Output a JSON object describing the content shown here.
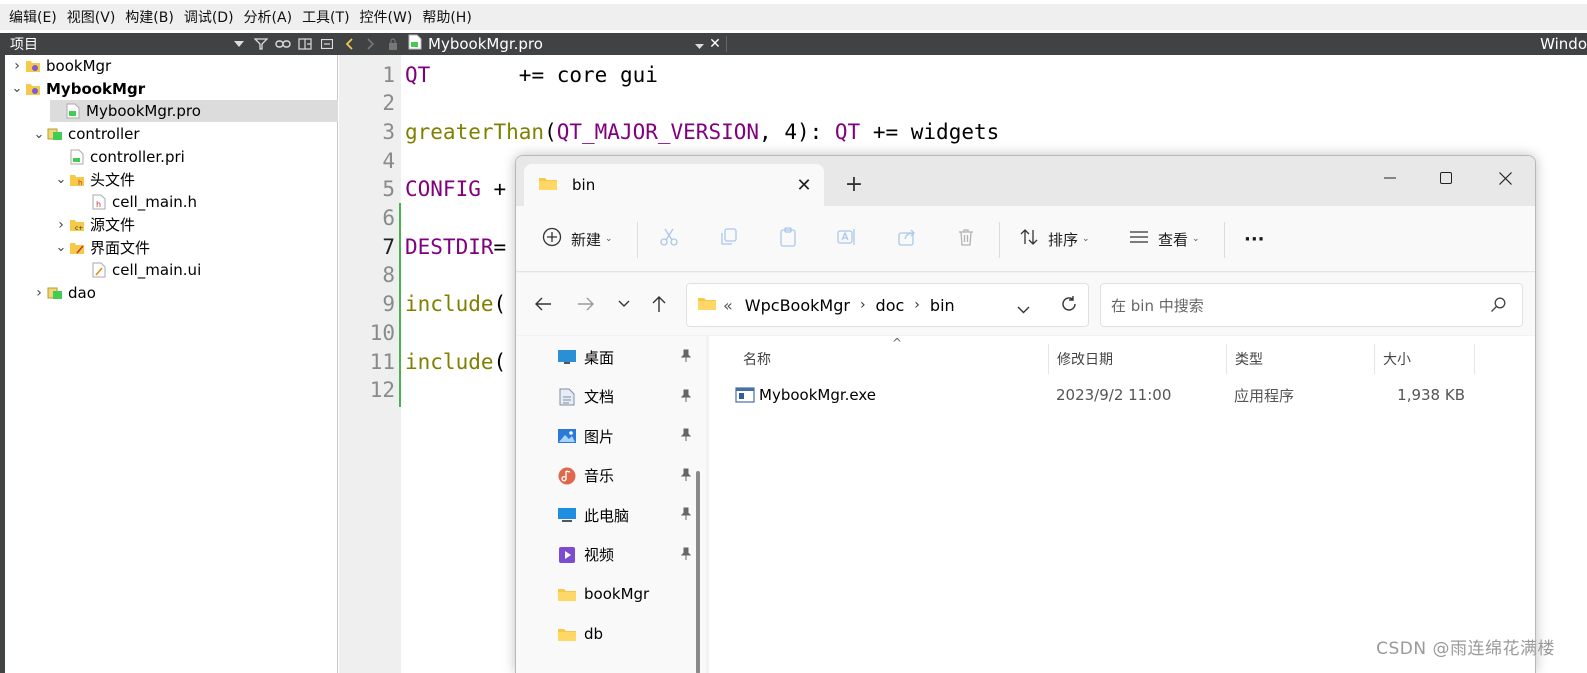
{
  "menubar": {
    "items": [
      "编辑(E)",
      "视图(V)",
      "构建(B)",
      "调试(D)",
      "分析(A)",
      "工具(T)",
      "控件(W)",
      "帮助(H)"
    ]
  },
  "project_pane": {
    "title": "项目",
    "tree": [
      {
        "label": "bookMgr",
        "level": 0,
        "arrow": "collapsed",
        "icon": "qt-project-icon",
        "bold": false,
        "selected": false
      },
      {
        "label": "MybookMgr",
        "level": 0,
        "arrow": "expanded",
        "icon": "qt-project-icon",
        "bold": true,
        "selected": false
      },
      {
        "label": "MybookMgr.pro",
        "level": 1,
        "arrow": "none",
        "icon": "pro-file-icon",
        "bold": false,
        "selected": true
      },
      {
        "label": "controller",
        "level": 1,
        "arrow": "expanded",
        "icon": "subproject-icon",
        "bold": false,
        "selected": false
      },
      {
        "label": "controller.pri",
        "level": 2,
        "arrow": "none",
        "icon": "pri-file-icon",
        "bold": false,
        "selected": false
      },
      {
        "label": "头文件",
        "level": 2,
        "arrow": "expanded",
        "icon": "header-folder-icon",
        "bold": false,
        "selected": false
      },
      {
        "label": "cell_main.h",
        "level": 3,
        "arrow": "none",
        "icon": "header-file-icon",
        "bold": false,
        "selected": false
      },
      {
        "label": "源文件",
        "level": 2,
        "arrow": "collapsed",
        "icon": "source-folder-icon",
        "bold": false,
        "selected": false
      },
      {
        "label": "界面文件",
        "level": 2,
        "arrow": "expanded",
        "icon": "form-folder-icon",
        "bold": false,
        "selected": false
      },
      {
        "label": "cell_main.ui",
        "level": 3,
        "arrow": "none",
        "icon": "ui-file-icon",
        "bold": false,
        "selected": false
      },
      {
        "label": "dao",
        "level": 1,
        "arrow": "collapsed",
        "icon": "subproject-icon",
        "bold": false,
        "selected": false
      }
    ]
  },
  "editor_header": {
    "file_name": "MybookMgr.pro",
    "right_label": "Windo"
  },
  "editor": {
    "current_line": 7,
    "lines": [
      {
        "n": "1",
        "segments": [
          {
            "t": "QT",
            "c": "purple"
          },
          {
            "t": "       += core gui",
            "c": "plain"
          }
        ]
      },
      {
        "n": "2",
        "segments": []
      },
      {
        "n": "3",
        "segments": [
          {
            "t": "greaterThan",
            "c": "olive"
          },
          {
            "t": "(",
            "c": "plain"
          },
          {
            "t": "QT_MAJOR_VERSION",
            "c": "purple"
          },
          {
            "t": ", 4): ",
            "c": "plain"
          },
          {
            "t": "QT",
            "c": "purple"
          },
          {
            "t": " += widgets",
            "c": "plain"
          }
        ]
      },
      {
        "n": "4",
        "segments": []
      },
      {
        "n": "5",
        "segments": [
          {
            "t": "CONFIG",
            "c": "purple"
          },
          {
            "t": " +",
            "c": "plain"
          }
        ]
      },
      {
        "n": "6",
        "segments": []
      },
      {
        "n": "7",
        "segments": [
          {
            "t": "DESTDIR",
            "c": "purple"
          },
          {
            "t": "=",
            "c": "plain"
          }
        ]
      },
      {
        "n": "8",
        "segments": []
      },
      {
        "n": "9",
        "segments": [
          {
            "t": "include",
            "c": "olive"
          },
          {
            "t": "(",
            "c": "plain"
          }
        ]
      },
      {
        "n": "10",
        "segments": []
      },
      {
        "n": "11",
        "segments": [
          {
            "t": "include",
            "c": "olive"
          },
          {
            "t": "(",
            "c": "plain"
          }
        ]
      },
      {
        "n": "12",
        "segments": []
      }
    ]
  },
  "explorer": {
    "tab_title": "bin",
    "toolbar": {
      "new_label": "新建",
      "sort_label": "排序",
      "view_label": "查看",
      "more_label": "···"
    },
    "breadcrumb": {
      "overflow": "«",
      "parts": [
        "WpcBookMgr",
        "doc",
        "bin"
      ]
    },
    "search_placeholder": "在 bin 中搜索",
    "nav_items": [
      {
        "label": "桌面",
        "icon": "desktop-icon",
        "pinned": true
      },
      {
        "label": "文档",
        "icon": "documents-icon",
        "pinned": true
      },
      {
        "label": "图片",
        "icon": "pictures-icon",
        "pinned": true
      },
      {
        "label": "音乐",
        "icon": "music-icon",
        "pinned": true
      },
      {
        "label": "此电脑",
        "icon": "this-pc-icon",
        "pinned": true
      },
      {
        "label": "视频",
        "icon": "videos-icon",
        "pinned": true
      },
      {
        "label": "bookMgr",
        "icon": "folder-icon",
        "pinned": false
      },
      {
        "label": "db",
        "icon": "folder-icon",
        "pinned": false
      }
    ],
    "columns": {
      "name": "名称",
      "modified": "修改日期",
      "type": "类型",
      "size": "大小"
    },
    "files": [
      {
        "name": "MybookMgr.exe",
        "modified": "2023/9/2 11:00",
        "type": "应用程序",
        "size": "1,938 KB"
      }
    ]
  },
  "watermark": "CSDN @雨连绵花满楼",
  "colors": {
    "qt_dark": "#404244",
    "keyword_purple": "#800080",
    "function_olive": "#808000",
    "change_bar_green": "#4caf50",
    "folder_yellow": "#f7c948"
  }
}
